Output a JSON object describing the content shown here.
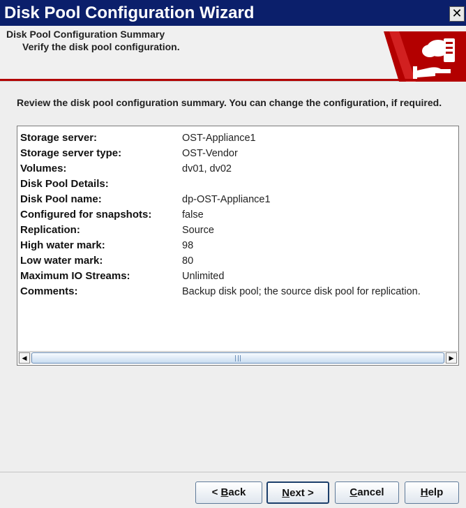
{
  "window": {
    "title": "Disk Pool Configuration Wizard",
    "close_glyph": "✕"
  },
  "banner": {
    "title": "Disk Pool Configuration Summary",
    "subtitle": "Verify the disk pool configuration.",
    "graphic_icon": "cloud-storage-hand-icon",
    "accent_color": "#b30000"
  },
  "intro_text": "Review the disk pool configuration summary. You can change the configuration, if required.",
  "summary": [
    {
      "label": "Storage server:",
      "value": "OST-Appliance1"
    },
    {
      "label": "Storage server type:",
      "value": "OST-Vendor"
    },
    {
      "label": "Volumes:",
      "value": "dv01, dv02"
    },
    {
      "label": "Disk Pool Details:",
      "value": ""
    },
    {
      "label": "Disk Pool name:",
      "value": "dp-OST-Appliance1"
    },
    {
      "label": "Configured for snapshots:",
      "value": "false"
    },
    {
      "label": "Replication:",
      "value": "Source"
    },
    {
      "label": "High water mark:",
      "value": "98"
    },
    {
      "label": "Low water mark:",
      "value": "80"
    },
    {
      "label": "Maximum IO Streams:",
      "value": "Unlimited"
    },
    {
      "label": "Comments:",
      "value": "Backup disk pool; the source disk pool for replication."
    }
  ],
  "scrollbar": {
    "left_arrow": "◀",
    "right_arrow": "▶"
  },
  "buttons": {
    "back_prefix": "< ",
    "back_mnemonic": "B",
    "back_rest": "ack",
    "next_mnemonic": "N",
    "next_rest": "ext >",
    "cancel_mnemonic": "C",
    "cancel_rest": "ancel",
    "help_mnemonic": "H",
    "help_rest": "elp"
  }
}
